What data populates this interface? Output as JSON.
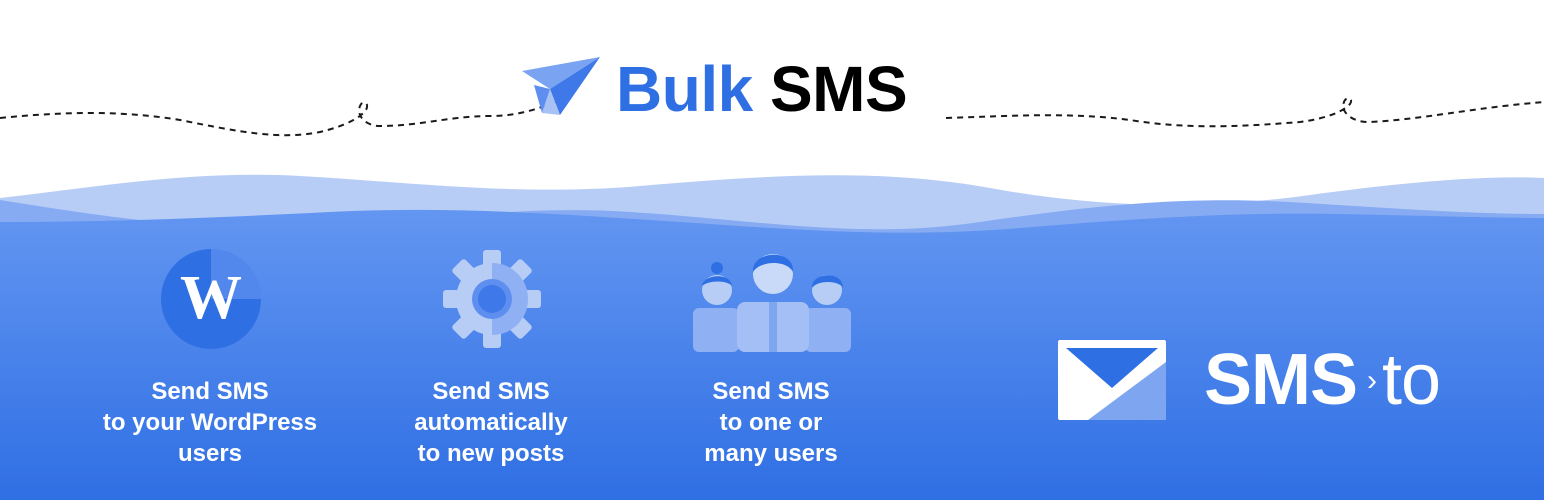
{
  "header": {
    "title_word_1": "Bulk",
    "title_word_2": "SMS",
    "icon": "paper-plane-icon"
  },
  "features": [
    {
      "icon": "wordpress-icon",
      "lines": [
        "Send SMS",
        "to your WordPress",
        "users"
      ]
    },
    {
      "icon": "gear-icon",
      "lines": [
        "Send SMS",
        "automatically",
        "to new posts"
      ]
    },
    {
      "icon": "users-group-icon",
      "lines": [
        "Send SMS",
        "to one or",
        "many users"
      ]
    }
  ],
  "logo": {
    "icon": "envelope-icon",
    "brand_name": "SMS",
    "brand_separator": "›",
    "brand_tld": "to"
  },
  "colors": {
    "accent": "#2f6fe4",
    "background_top": "#ffffff",
    "wave_light": "#b7cdf6",
    "wave_mid": "#7ea6f0",
    "gradient_top": "#5e8ff0",
    "gradient_bottom": "#2f6fe4"
  }
}
